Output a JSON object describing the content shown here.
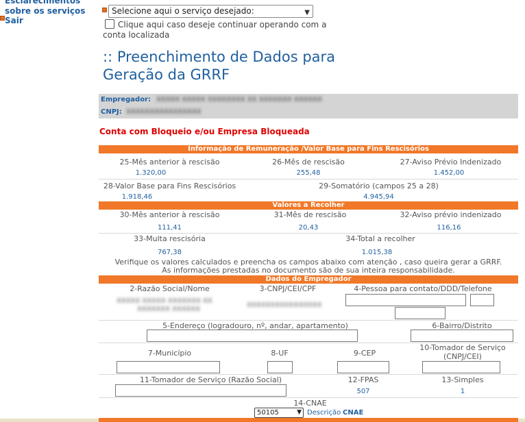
{
  "nav": {
    "item1": "Esclarecimentos",
    "item2": "sobre os serviços",
    "item3": "Sair"
  },
  "service_select": {
    "selected": "Selecione aqui o serviço desejado:"
  },
  "checkbox": {
    "label": "Clique aqui caso deseje continuar operando com a conta localizada",
    "checked": false
  },
  "title": ":: Preenchimento de Dados para Geração da GRRF",
  "employer": {
    "label_empregador": "Empregador:",
    "label_cnpj": "CNPJ:"
  },
  "alert": "Conta com Bloqueio  e/ou  Empresa Bloqueada",
  "sections": {
    "remuneracao": "Informação de Remuneração /Valor Base para Fins Rescisórios",
    "recolher": "Valores a Recolher",
    "empregador": "Dados do Empregador"
  },
  "remuneracao": {
    "f25_label": "25-Mês anterior à rescisão",
    "f25_value": "1.320,00",
    "f26_label": "26-Mês de rescisão",
    "f26_value": "255,48",
    "f27_label": "27-Aviso Prévio Indenizado",
    "f27_value": "1.452,00",
    "f28_label": "28-Valor Base para Fins Rescisórios",
    "f28_value": "1.918,46",
    "f29_label": "29-Somatório (campos 25 a 28)",
    "f29_value": "4.945,94"
  },
  "recolher": {
    "f30_label": "30-Mês anterior à rescisão",
    "f30_value": "111,41",
    "f31_label": "31-Mês de rescisão",
    "f31_value": "20,43",
    "f32_label": "32-Aviso prévio indenizado",
    "f32_value": "116,16",
    "f33_label": "33-Multa rescisória",
    "f33_value": "767,38",
    "f34_label": "34-Total a recolher",
    "f34_value": "1.015,38"
  },
  "note": {
    "line1": "Verifique os valores calculados e preencha os campos abaixo com atenção , caso queira gerar a GRRF.",
    "line2": "As informações prestadas no documento são de sua inteira responsabilidade."
  },
  "empregador": {
    "f2_label": "2-Razão Social/Nome",
    "f3_label": "3-CNPJ/CEI/CPF",
    "f4_label": "4-Pessoa para contato/DDD/Telefone",
    "f5_label": "5-Endereço (logradouro, nº, andar, apartamento)",
    "f6_label": "6-Bairro/Distrito",
    "f7_label": "7-Município",
    "f8_label": "8-UF",
    "f9_label": "9-CEP",
    "f10_label": "10-Tomador de Serviço (CNPJ/CEI)",
    "f11_label": "11-Tomador de Serviço (Razão Social)",
    "f12_label": "12-FPAS",
    "f12_value": "507",
    "f13_label": "13-Simples",
    "f13_value": "1",
    "f14_label": "14-CNAE",
    "f14_value": "50105",
    "cnae_desc_prefix": "Descrição",
    "cnae_desc_link": "CNAE"
  },
  "colors": {
    "orange": "#f07828",
    "blue": "#1f5f9f",
    "alert": "#e00000",
    "gray_band": "#d4d4d4"
  }
}
